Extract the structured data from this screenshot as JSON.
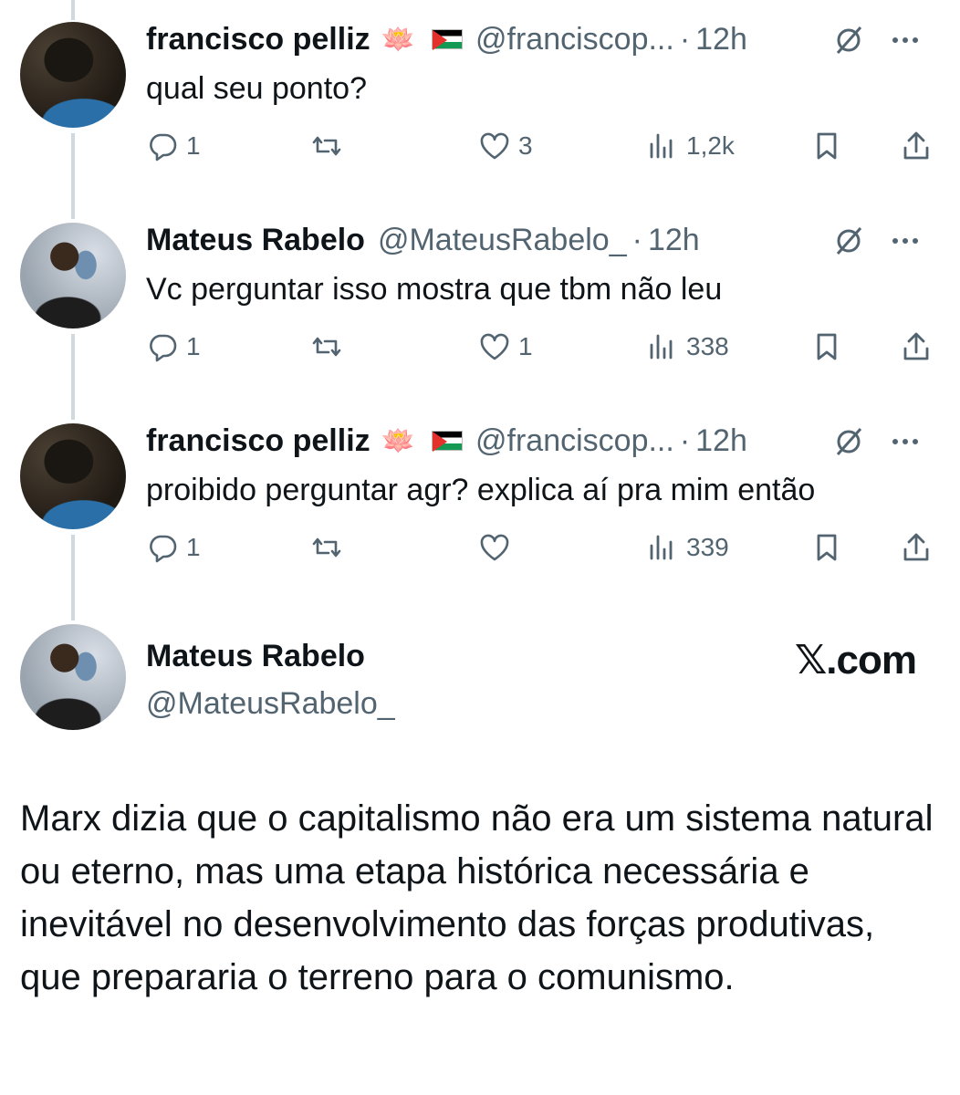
{
  "replies": [
    {
      "name": "francisco pelliz",
      "emoji": "🪷",
      "handle": "@franciscop...",
      "dot": "·",
      "time": "12h",
      "text": "qual seu ponto?",
      "counts": {
        "replies": "1",
        "reposts": "",
        "likes": "3",
        "views": "1,2k"
      }
    },
    {
      "name": "Mateus Rabelo",
      "emoji": "",
      "handle": "@MateusRabelo_",
      "dot": "·",
      "time": "12h",
      "text": "Vc perguntar isso mostra que tbm não leu",
      "counts": {
        "replies": "1",
        "reposts": "",
        "likes": "1",
        "views": "338"
      }
    },
    {
      "name": "francisco pelliz",
      "emoji": "🪷",
      "handle": "@franciscop...",
      "dot": "·",
      "time": "12h",
      "text": "proibido perguntar agr? explica aí pra mim então",
      "counts": {
        "replies": "1",
        "reposts": "",
        "likes": "",
        "views": "339"
      }
    }
  ],
  "quoted": {
    "name": "Mateus Rabelo",
    "handle": "@MateusRabelo_",
    "brand": "𝕏.com",
    "text": "Marx dizia que o capitalismo não era um sistema natural ou eterno, mas uma etapa histórica necessária e inevitável no desenvolvimento das forças produtivas, que prepararia o terreno para o comunismo."
  },
  "colors": {
    "text": "#0f1419",
    "secondary": "#536471",
    "thread_line": "#cfd9de"
  },
  "icons": [
    "reply-icon",
    "repost-icon",
    "like-icon",
    "views-icon",
    "bookmark-icon",
    "share-icon",
    "grok-icon",
    "more-icon",
    "lotus-emoji",
    "palestine-flag-icon"
  ]
}
